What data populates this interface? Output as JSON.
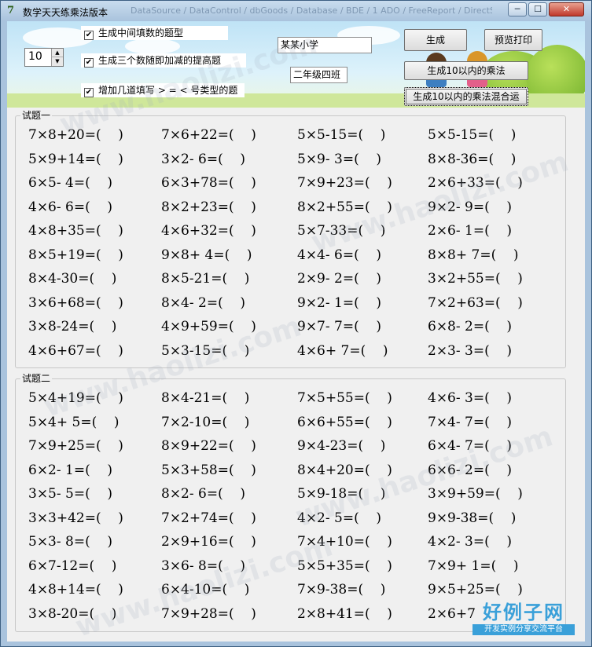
{
  "window": {
    "title": "数学天天练乘法版本",
    "title_ghost": "DataSource / DataControl / dbGoods / Database / BDE / 1 ADO / FreeReport / DirectSQL",
    "icon": "app-icon",
    "min_label": "─",
    "max_label": "☐",
    "close_label": "✕"
  },
  "controls": {
    "count_value": "10",
    "check1": "生成中间填数的题型",
    "check2": "生成三个数随即加减的提高题",
    "check3": "增加几道填写 > = < 号类型的题",
    "school": "某某小学",
    "grade": "二年级四班",
    "generate_button": "生成",
    "preview_button": "预览打印",
    "mult10_button": "生成10以内的乘法",
    "mixed_button": "生成10以内的乘法混合运"
  },
  "group1": {
    "label": "试题一",
    "rows": [
      [
        "7×8+20=(    )",
        "7×6+22=(    )",
        "5×5-15=(    )",
        "5×5-15=(    )"
      ],
      [
        "5×9+14=(    )",
        "3×2- 6=(    )",
        "5×9- 3=(    )",
        "8×8-36=(    )"
      ],
      [
        "6×5- 4=(    )",
        "6×3+78=(    )",
        "7×9+23=(    )",
        "2×6+33=(    )"
      ],
      [
        "4×6- 6=(    )",
        "8×2+23=(    )",
        "8×2+55=(    )",
        "9×2- 9=(    )"
      ],
      [
        "4×8+35=(    )",
        "4×6+32=(    )",
        "5×7-33=(    )",
        "2×6- 1=(    )"
      ],
      [
        "8×5+19=(    )",
        "9×8+ 4=(    )",
        "4×4- 6=(    )",
        "8×8+ 7=(    )"
      ],
      [
        "8×4-30=(    )",
        "8×5-21=(    )",
        "2×9- 2=(    )",
        "3×2+55=(    )"
      ],
      [
        "3×6+68=(    )",
        "8×4- 2=(    )",
        "9×2- 1=(    )",
        "7×2+63=(    )"
      ],
      [
        "3×8-24=(    )",
        "4×9+59=(    )",
        "9×7- 7=(    )",
        "6×8- 2=(    )"
      ],
      [
        "4×6+67=(    )",
        "5×3-15=(    )",
        "4×6+ 7=(    )",
        "2×3- 3=(    )"
      ]
    ]
  },
  "group2": {
    "label": "试题二",
    "rows": [
      [
        "5×4+19=(    )",
        "8×4-21=(    )",
        "7×5+55=(    )",
        "4×6- 3=(    )"
      ],
      [
        "5×4+ 5=(    )",
        "7×2-10=(    )",
        "6×6+55=(    )",
        "7×4- 7=(    )"
      ],
      [
        "7×9+25=(    )",
        "8×9+22=(    )",
        "9×4-23=(    )",
        "6×4- 7=(    )"
      ],
      [
        "6×2- 1=(    )",
        "5×3+58=(    )",
        "8×4+20=(    )",
        "6×6- 2=(    )"
      ],
      [
        "3×5- 5=(    )",
        "8×2- 6=(    )",
        "5×9-18=(    )",
        "3×9+59=(    )"
      ],
      [
        "3×3+42=(    )",
        "7×2+74=(    )",
        "4×2- 5=(    )",
        "9×9-38=(    )"
      ],
      [
        "5×3- 8=(    )",
        "2×9+16=(    )",
        "7×4+10=(    )",
        "4×2- 3=(    )"
      ],
      [
        "6×7-12=(    )",
        "3×6- 8=(    )",
        "5×5+35=(    )",
        "7×9+ 1=(    )"
      ],
      [
        "4×8+14=(    )",
        "6×4-10=(    )",
        "7×9-38=(    )",
        "9×5+25=(    )"
      ],
      [
        "3×8-20=(    )",
        "7×9+28=(    )",
        "2×8+41=(    )",
        "2×6+7"
      ]
    ]
  },
  "watermark": "www.haolizi.com",
  "logo": {
    "main": "好例子网",
    "sub": "开发实例分享交流平台"
  }
}
